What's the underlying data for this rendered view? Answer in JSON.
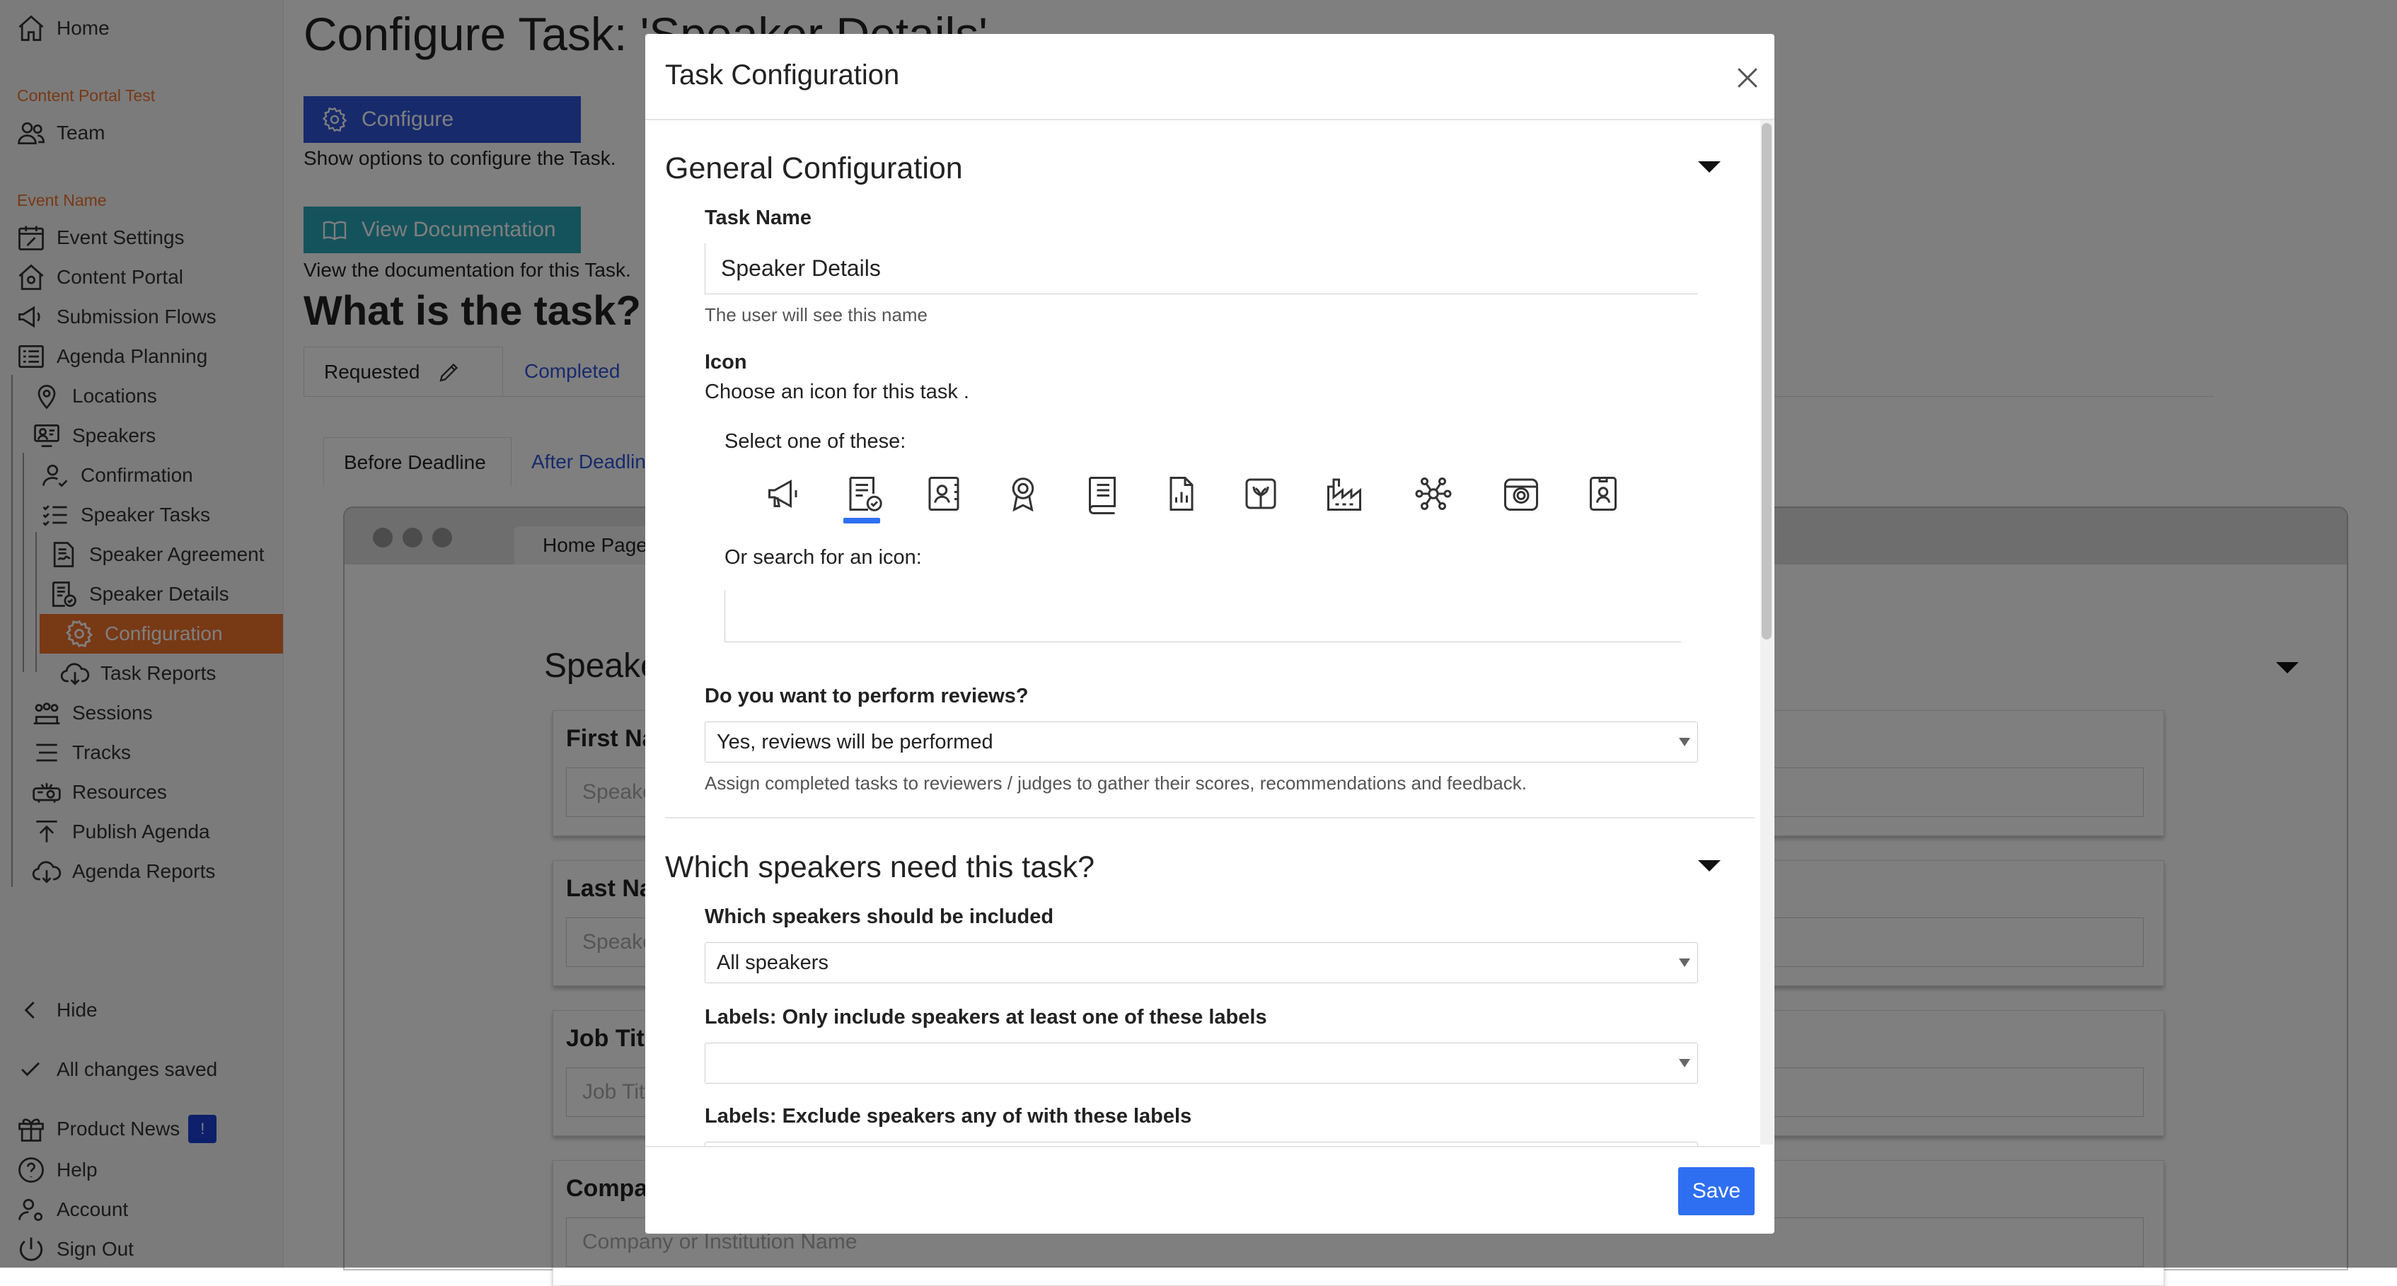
{
  "sidebar": {
    "home": "Home",
    "portal_section": "Content Portal Test",
    "team": "Team",
    "event_section": "Event Name",
    "event_settings": "Event Settings",
    "content_portal": "Content Portal",
    "submission_flows": "Submission Flows",
    "agenda_planning": "Agenda Planning",
    "locations": "Locations",
    "speakers": "Speakers",
    "confirmation": "Confirmation",
    "speaker_tasks": "Speaker Tasks",
    "speaker_agreement": "Speaker Agreement",
    "speaker_details": "Speaker Details",
    "configuration": "Configuration",
    "task_reports": "Task Reports",
    "sessions": "Sessions",
    "tracks": "Tracks",
    "resources": "Resources",
    "publish_agenda": "Publish Agenda",
    "agenda_reports": "Agenda Reports",
    "hide": "Hide",
    "all_saved": "All changes saved",
    "product_news": "Product News",
    "product_news_badge": "!",
    "help": "Help",
    "account": "Account",
    "sign_out": "Sign Out"
  },
  "main": {
    "page_title": "Configure Task: 'Speaker Details'",
    "configure_btn": "Configure",
    "configure_help": "Show options to configure the Task.",
    "doc_btn": "View Documentation",
    "doc_help": "View the documentation for this Task.",
    "what_title": "What is the task?",
    "tabs": [
      "Requested",
      "Completed"
    ],
    "subtabs": [
      "Before Deadline",
      "After Deadline"
    ],
    "browser_tab": "Home Page",
    "section_heading": "Speaker Details",
    "fields": [
      {
        "label": "First Name",
        "placeholder": "Speaker First Name"
      },
      {
        "label": "Last Name",
        "placeholder": "Speaker Last Name"
      },
      {
        "label": "Job Title",
        "placeholder": "Job Title"
      },
      {
        "label": "Company",
        "placeholder": "Company or Institution Name"
      }
    ]
  },
  "modal": {
    "title": "Task Configuration",
    "general_title": "General Configuration",
    "task_name_label": "Task Name",
    "task_name_value": "Speaker Details",
    "task_name_help": "The user will see this name",
    "icon_label": "Icon",
    "icon_help": "Choose an icon for this task .",
    "select_one": "Select one of these:",
    "icons": [
      "megaphone-icon",
      "checklist-icon",
      "contact-card-icon",
      "award-icon",
      "book-icon",
      "document-chart-icon",
      "gift-icon",
      "factory-icon",
      "network-icon",
      "camera-icon",
      "id-badge-icon"
    ],
    "selected_icon": "checklist-icon",
    "search_label": "Or search for an icon:",
    "search_value": "",
    "reviews_label": "Do you want to perform reviews?",
    "reviews_value": "Yes, reviews will be performed",
    "reviews_help": "Assign completed tasks to reviewers / judges to gather their scores, recommendations and feedback.",
    "speakers_title": "Which speakers need this task?",
    "include_label": "Which speakers should be included",
    "include_value": "All speakers",
    "labels_include_label": "Labels: Only include speakers at least one of these labels",
    "labels_include_value": "",
    "labels_exclude_label": "Labels: Exclude speakers any of with these labels",
    "save": "Save"
  },
  "colors": {
    "accent_orange": "#f0732b",
    "primary_blue": "#2e55d8",
    "teal": "#2aa6b8",
    "save_blue": "#2e6ff2",
    "selected_underline": "#2e6ff2"
  }
}
